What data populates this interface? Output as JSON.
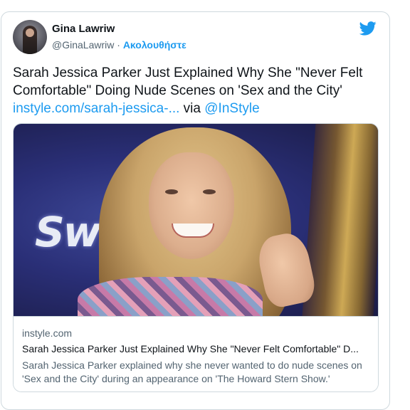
{
  "tweet": {
    "author_name": "Gina Lawriw",
    "handle": "@GinaLawriw",
    "separator": " · ",
    "follow_label": "Ακολουθήστε",
    "text_line": "Sarah Jessica Parker Just Explained Why She \"Never Felt Comfortable\" Doing Nude Scenes on 'Sex and the City'",
    "link_text": "instyle.com/sarah-jessica-...",
    "via_text": " via ",
    "mention": "@InStyle"
  },
  "link_card": {
    "domain": "instyle.com",
    "title": "Sarah Jessica Parker Just Explained Why She \"Never Felt Comfortable\" D...",
    "description": "Sarah Jessica Parker explained why she never wanted to do nude scenes on 'Sex and the City' during an appearance on 'The Howard Stern Show.'"
  },
  "photo": {
    "backdrop_logo_text": "Swiff"
  },
  "icons": {
    "brand": "twitter-bird-icon",
    "avatar": "profile-avatar"
  },
  "colors": {
    "accent": "#1d9bf0",
    "text": "#0f1419",
    "secondary": "#536471",
    "border": "#cfd9de"
  }
}
